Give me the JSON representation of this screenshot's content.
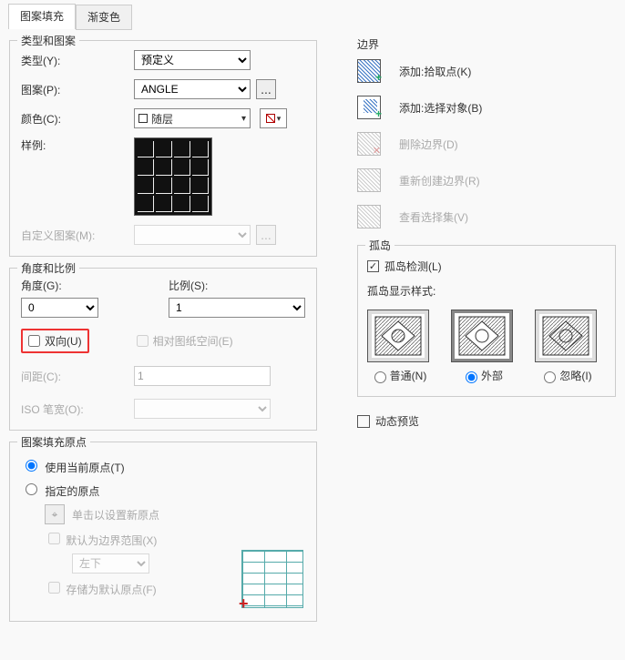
{
  "tabs": {
    "hatch": "图案填充",
    "gradient": "渐变色"
  },
  "type_pattern": {
    "legend": "类型和图案",
    "type_label": "类型(Y):",
    "type_value": "预定义",
    "pattern_label": "图案(P):",
    "pattern_value": "ANGLE",
    "color_label": "颜色(C):",
    "color_value": "随层",
    "sample_label": "样例:",
    "custom_label": "自定义图案(M):"
  },
  "angle_scale": {
    "legend": "角度和比例",
    "angle_label": "角度(G):",
    "angle_value": "0",
    "scale_label": "比例(S):",
    "scale_value": "1",
    "bidir_label": "双向(U)",
    "relpaper_label": "相对图纸空间(E)",
    "spacing_label": "间距(C):",
    "spacing_value": "1",
    "iso_label": "ISO 笔宽(O):"
  },
  "origin": {
    "legend": "图案填充原点",
    "use_current": "使用当前原点(T)",
    "specified": "指定的原点",
    "click_set": "单击以设置新原点",
    "default_extent": "默认为边界范围(X)",
    "bl": "左下",
    "store_default": "存储为默认原点(F)"
  },
  "boundary": {
    "legend": "边界",
    "add_pick": "添加:拾取点(K)",
    "add_select": "添加:选择对象(B)",
    "remove": "删除边界(D)",
    "recreate": "重新创建边界(R)",
    "view_sel": "查看选择集(V)"
  },
  "island": {
    "legend": "孤岛",
    "detect": "孤岛检测(L)",
    "style_label": "孤岛显示样式:",
    "normal": "普通(N)",
    "outer": "外部",
    "ignore": "忽略(I)"
  },
  "dyn_preview": "动态预览"
}
